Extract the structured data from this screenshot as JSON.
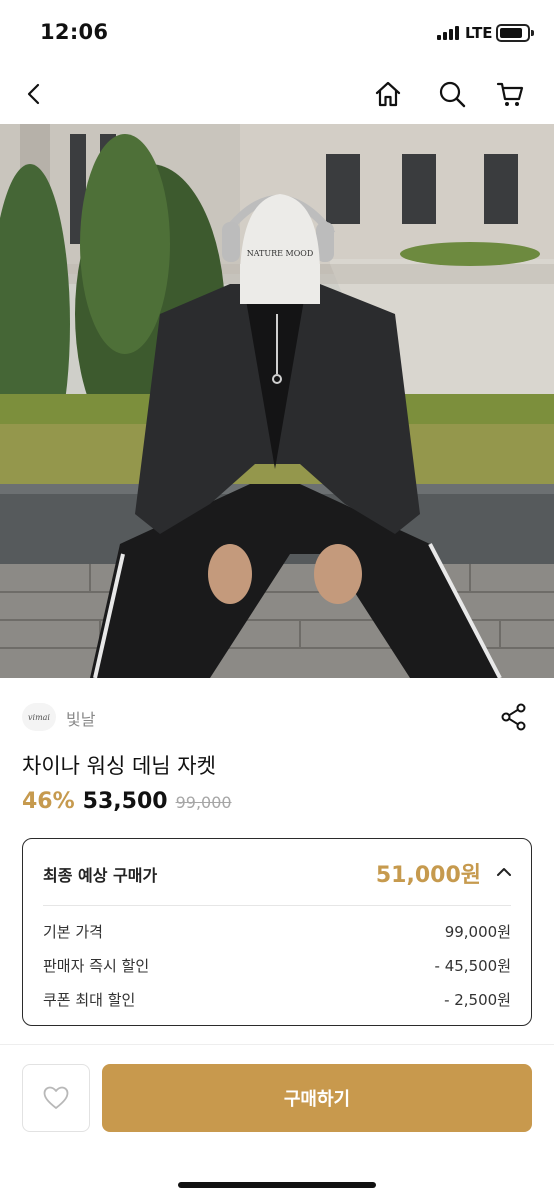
{
  "status_bar": {
    "time": "12:06",
    "network": "LTE"
  },
  "nav": {
    "back_icon": "chevron-left-icon",
    "home_icon": "home-icon",
    "search_icon": "search-icon",
    "cart_icon": "cart-icon"
  },
  "hero": {
    "badge_text": "NATURE MOOD"
  },
  "brand": {
    "logo_text": "vimai",
    "name": "빛날",
    "share_icon": "share-icon"
  },
  "product": {
    "title": "차이나 워싱 데님 자켓",
    "discount": "46%",
    "price": "53,500",
    "original_price": "99,000"
  },
  "price_box": {
    "label": "최종 예상 구매가",
    "final_price": "51,000원",
    "expanded": true,
    "lines": [
      {
        "label": "기본 가격",
        "value": "99,000원"
      },
      {
        "label": "판매자 즉시 할인",
        "value": "- 45,500원"
      },
      {
        "label": "쿠폰 최대 할인",
        "value": "- 2,500원"
      }
    ]
  },
  "bottom_bar": {
    "like_icon": "heart-icon",
    "buy_label": "구매하기"
  },
  "colors": {
    "accent": "#c8994d",
    "discount": "#c69a4e",
    "muted": "#a6a6a6"
  }
}
